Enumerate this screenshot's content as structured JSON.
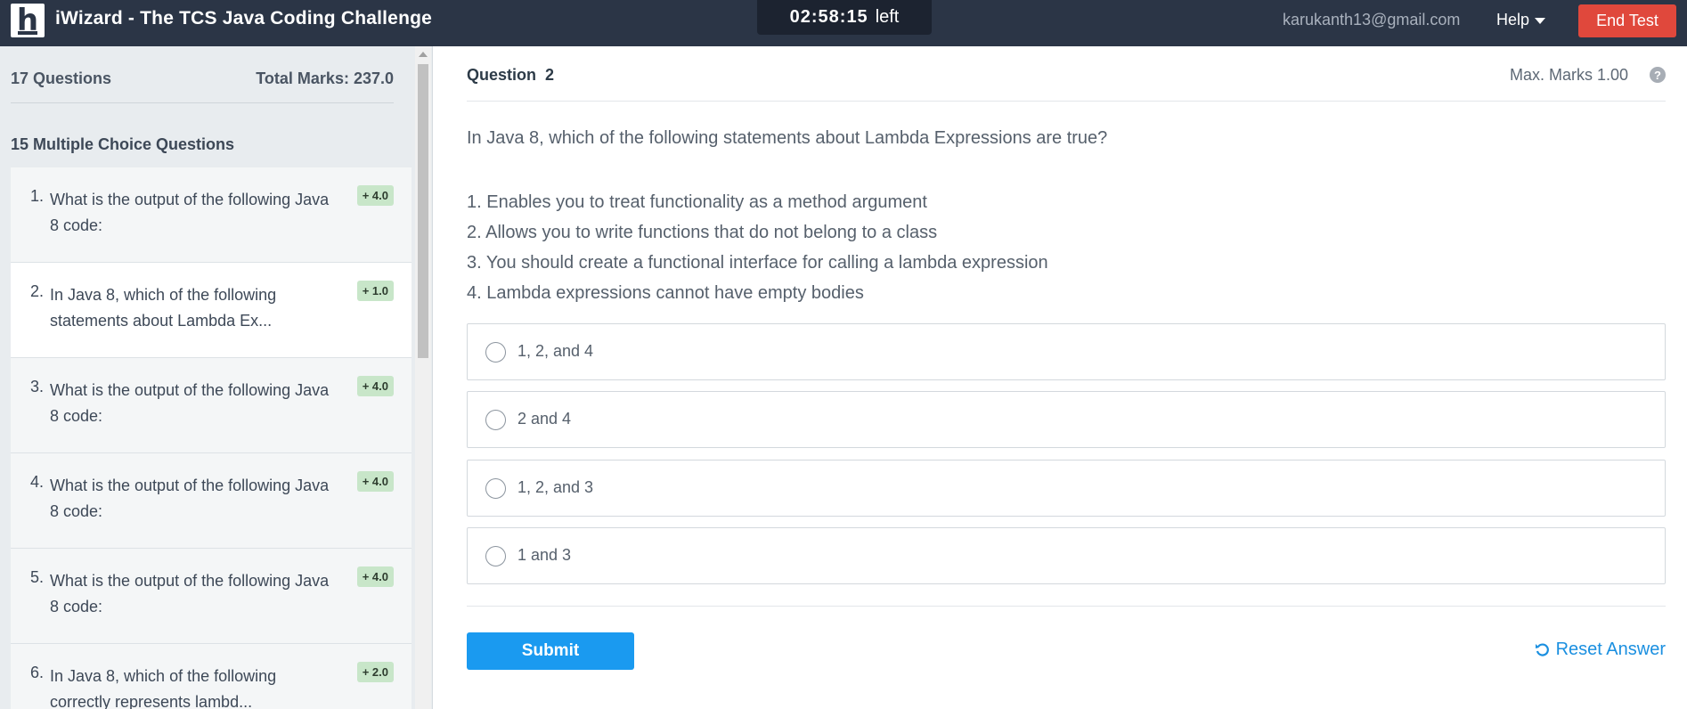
{
  "header": {
    "logo_letter": "h",
    "title": "iWizard - The TCS Java Coding Challenge",
    "timer": {
      "time": "02:58:15",
      "suffix": "left"
    },
    "user_email": "karukanth13@gmail.com",
    "help_label": "Help",
    "end_test_label": "End Test"
  },
  "sidebar": {
    "questions_count": "17 Questions",
    "total_marks": "Total Marks: 237.0",
    "mcq_heading": "15 Multiple Choice Questions",
    "items": [
      {
        "num": "1.",
        "text": "What is the output of the following Java 8 code:",
        "marks": "+ 4.0",
        "active": false
      },
      {
        "num": "2.",
        "text": "In Java 8, which of the following statements about Lambda Ex...",
        "marks": "+ 1.0",
        "active": true
      },
      {
        "num": "3.",
        "text": "What is the output of the following Java 8 code:",
        "marks": "+ 4.0",
        "active": false
      },
      {
        "num": "4.",
        "text": "What is the output of the following Java 8 code:",
        "marks": "+ 4.0",
        "active": false
      },
      {
        "num": "5.",
        "text": "What is the output of the following Java 8 code:",
        "marks": "+ 4.0",
        "active": false
      },
      {
        "num": "6.",
        "text": "In Java 8, which of the following correctly represents lambd...",
        "marks": "+ 2.0",
        "active": false
      }
    ]
  },
  "question": {
    "label": "Question",
    "number": "2",
    "max_marks": "Max. Marks 1.00",
    "help_glyph": "?",
    "text": "In Java 8, which of the following statements about Lambda Expressions are true?",
    "statements": [
      "1. Enables you to treat functionality as a method argument",
      "2. Allows you to write functions that do not belong to a class",
      "3. You should create a functional interface for calling a lambda expression",
      "4. Lambda expressions cannot have empty bodies"
    ],
    "options": [
      "1, 2, and 4",
      "2 and 4",
      "1, 2, and 3",
      "1 and 3"
    ],
    "submit_label": "Submit",
    "reset_label": "Reset Answer"
  },
  "colors": {
    "topbar": "#2b3546",
    "end_test": "#e0483c",
    "submit": "#1a9af0",
    "link": "#1a8fe0",
    "badge": "#c8e6c9"
  }
}
